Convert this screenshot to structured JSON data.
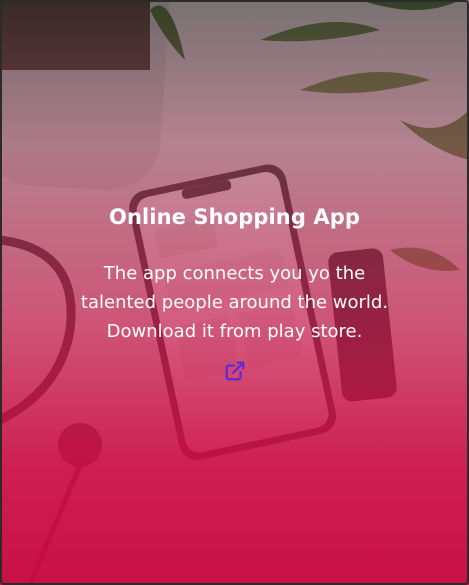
{
  "card": {
    "title": "Online Shopping App",
    "description_lines": [
      "The app connects you yo the",
      "talented people around the world.",
      "Download it from play store."
    ],
    "link_icon": "external-link-icon"
  },
  "colors": {
    "overlay_accent": "#cd0f46",
    "text": "#ffffff",
    "link_icon": "#5b2bd6"
  }
}
